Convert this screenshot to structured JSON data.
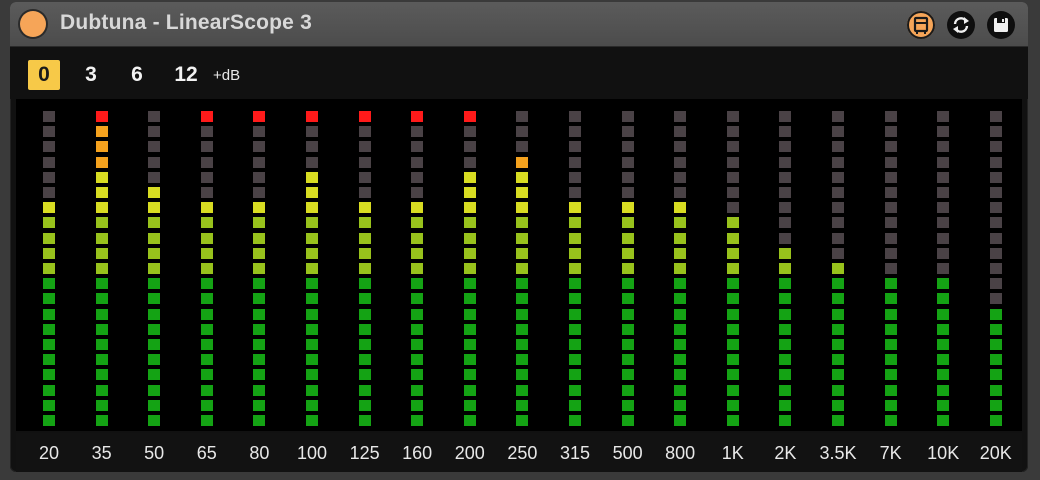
{
  "window": {
    "title": "Dubtuna - LinearScope 3"
  },
  "toolbar": {
    "db_options": [
      "0",
      "3",
      "6",
      "12"
    ],
    "active_option": "0",
    "unit": "+dB"
  },
  "colors": {
    "off": "#4a4246",
    "green": "#14a314",
    "lime": "#98c21c",
    "yellow": "#d8dc22",
    "orange": "#f5a21e",
    "red": "#ff1a1a"
  },
  "meter": {
    "segments_per_band": 21,
    "bands": [
      {
        "label": "20",
        "level": 15,
        "peak": false
      },
      {
        "label": "35",
        "level": 20,
        "peak": true
      },
      {
        "label": "50",
        "level": 16,
        "peak": false
      },
      {
        "label": "65",
        "level": 15,
        "peak": true
      },
      {
        "label": "80",
        "level": 15,
        "peak": true
      },
      {
        "label": "100",
        "level": 17,
        "peak": true
      },
      {
        "label": "125",
        "level": 15,
        "peak": true
      },
      {
        "label": "160",
        "level": 15,
        "peak": true
      },
      {
        "label": "200",
        "level": 17,
        "peak": true
      },
      {
        "label": "250",
        "level": 18,
        "peak": false
      },
      {
        "label": "315",
        "level": 15,
        "peak": false
      },
      {
        "label": "500",
        "level": 15,
        "peak": false
      },
      {
        "label": "800",
        "level": 15,
        "peak": false
      },
      {
        "label": "1K",
        "level": 14,
        "peak": false
      },
      {
        "label": "2K",
        "level": 12,
        "peak": false
      },
      {
        "label": "3.5K",
        "level": 11,
        "peak": false
      },
      {
        "label": "7K",
        "level": 10,
        "peak": false
      },
      {
        "label": "10K",
        "level": 10,
        "peak": false
      },
      {
        "label": "20K",
        "level": 8,
        "peak": false
      }
    ]
  }
}
